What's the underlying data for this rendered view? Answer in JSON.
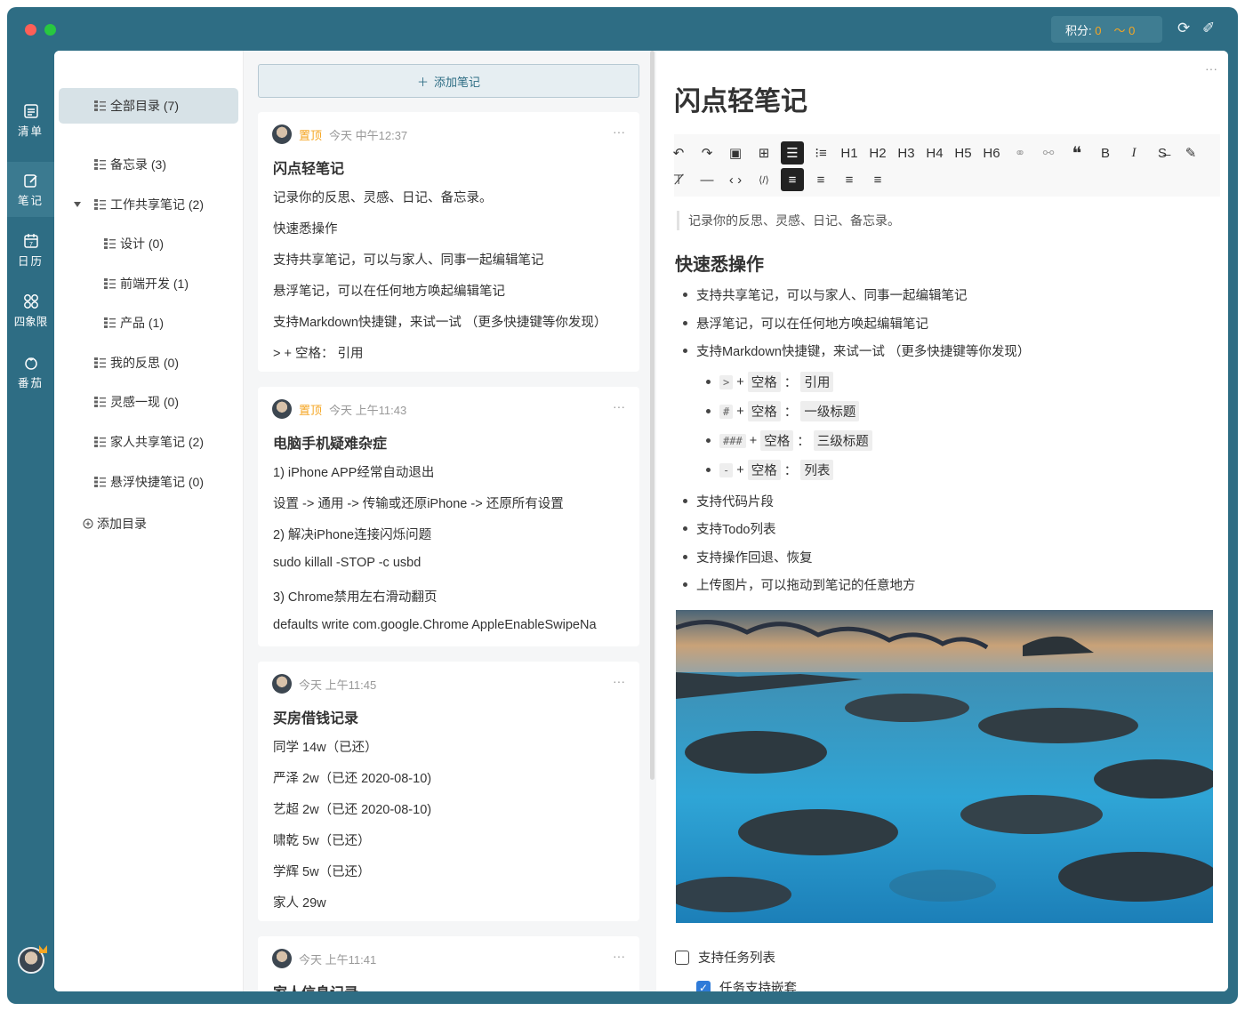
{
  "header": {
    "score_label": "积分:",
    "score_value": "0",
    "trend_value": "0",
    "sync_icon": "sync-icon",
    "pin_icon": "pin-icon"
  },
  "rail": [
    {
      "label": "清单",
      "icon": "list-icon"
    },
    {
      "label": "笔记",
      "icon": "note-edit-icon"
    },
    {
      "label": "日历",
      "icon": "calendar-icon"
    },
    {
      "label": "四象限",
      "icon": "quadrant-icon"
    },
    {
      "label": "番茄",
      "icon": "tomato-icon"
    }
  ],
  "directories": {
    "all": "全部目录 (7)",
    "items": [
      "备忘录 (3)",
      "工作共享笔记 (2)",
      "设计 (0)",
      "前端开发 (1)",
      "产品 (1)",
      "我的反思 (0)",
      "灵感一现 (0)",
      "家人共享笔记 (2)",
      "悬浮快捷笔记 (0)"
    ],
    "add_label": "添加目录"
  },
  "notes": {
    "add_label": "添加笔记",
    "cards": [
      {
        "pin": "置顶",
        "time": "今天 中午12:37",
        "title": "闪点轻笔记",
        "lines": [
          "记录你的反思、灵感、日记、备忘录。",
          "快速悉操作",
          "支持共享笔记，可以与家人、同事一起编辑笔记",
          "悬浮笔记，可以在任何地方唤起编辑笔记",
          "支持Markdown快捷键，来试一试 （更多快捷键等你发现）",
          "> + 空格： 引用"
        ]
      },
      {
        "pin": "置顶",
        "time": "今天 上午11:43",
        "title": "电脑手机疑难杂症",
        "lines": [
          "1) iPhone APP经常自动退出",
          "设置 -> 通用 -> 传输或还原iPhone -> 还原所有设置",
          "2) 解决iPhone连接闪烁问题",
          "sudo killall -STOP -c usbd",
          "3) Chrome禁用左右滑动翻页",
          "defaults write com.google.Chrome AppleEnableSwipeNa"
        ]
      },
      {
        "pin": "",
        "time": "今天 上午11:45",
        "title": "买房借钱记录",
        "lines": [
          "同学 14w（已还）",
          "严泽 2w（已还 2020-08-10)",
          "艺超 2w（已还 2020-08-10)",
          "啸乾 5w（已还）",
          "学辉 5w（已还）",
          "家人 29w"
        ]
      },
      {
        "pin": "",
        "time": "今天 上午11:41",
        "title": "家人信息记录",
        "lines": []
      }
    ]
  },
  "editor": {
    "title": "闪点轻笔记",
    "toolbar_row1": [
      "↶",
      "↷",
      "▣",
      "⊞",
      "☰",
      "⁝≡",
      "H1",
      "H2",
      "H3",
      "H4",
      "H5",
      "H6",
      "⚭",
      "⚯",
      "❝",
      "B",
      "I",
      "S̶",
      "✎"
    ],
    "toolbar_row2": [
      "⊤̸",
      "—",
      "‹ ›",
      "⟨/⟩",
      "≡",
      "≡",
      "≡",
      "≡"
    ],
    "quote": "记录你的反思、灵感、日记、备忘录。",
    "heading": "快速悉操作",
    "bullets": [
      "支持共享笔记，可以与家人、同事一起编辑笔记",
      "悬浮笔记，可以在任何地方唤起编辑笔记",
      "支持Markdown快捷键，来试一试 （更多快捷键等你发现）"
    ],
    "sub_bullets": [
      {
        "key": ">",
        "plus": "+",
        "space": "空格",
        "colon": "：",
        "result": "引用"
      },
      {
        "key": "#",
        "plus": "+",
        "space": "空格",
        "colon": "：",
        "result": "一级标题"
      },
      {
        "key": "###",
        "plus": "+",
        "space": "空格",
        "colon": "：",
        "result": "三级标题"
      },
      {
        "key": "-",
        "plus": "+",
        "space": "空格",
        "colon": "：",
        "result": "列表"
      }
    ],
    "bullets2": [
      "支持代码片段",
      "支持Todo列表",
      "支持操作回退、恢复",
      "上传图片，可以拖动到笔记的任意地方"
    ],
    "task1": "支持任务列表",
    "task2": "任务支持嵌套"
  }
}
